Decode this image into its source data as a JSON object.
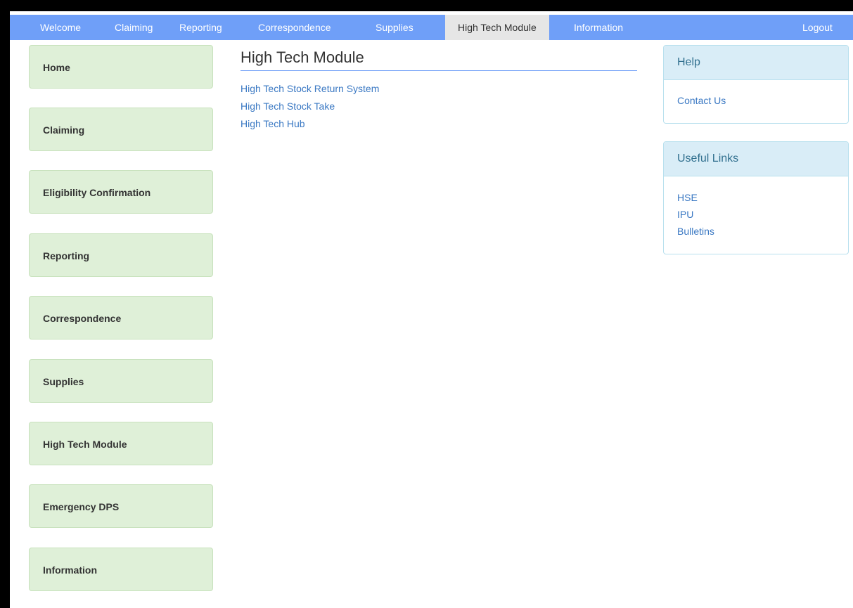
{
  "topnav": {
    "items": [
      "Welcome",
      "Claiming",
      "Reporting",
      "Correspondence",
      "Supplies",
      "High Tech Module",
      "Information"
    ],
    "active": "High Tech Module",
    "logout": "Logout"
  },
  "sidebar": {
    "items": [
      "Home",
      "Claiming",
      "Eligibility Confirmation",
      "Reporting",
      "Correspondence",
      "Supplies",
      "High Tech Module",
      "Emergency DPS",
      "Information"
    ]
  },
  "main": {
    "title": "High Tech Module",
    "links": [
      "High Tech Stock Return System",
      "High Tech Stock Take",
      "High Tech Hub"
    ]
  },
  "help": {
    "title": "Help",
    "links": [
      "Contact Us"
    ]
  },
  "useful_links": {
    "title": "Useful Links",
    "links": [
      "HSE",
      "IPU",
      "Bulletins"
    ]
  },
  "colors": {
    "nav_bg": "#6f9ff8",
    "sidebar_bg": "#dff0d8",
    "panel_head_bg": "#d9edf7",
    "link": "#3a78c3"
  }
}
